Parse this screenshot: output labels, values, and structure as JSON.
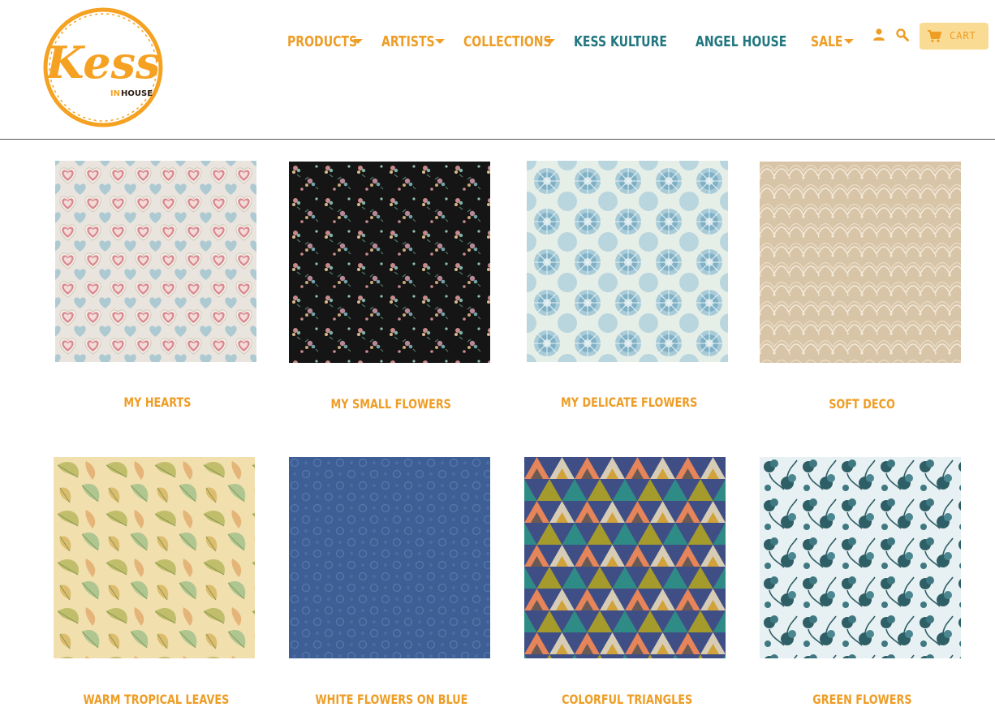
{
  "brand": {
    "logo_script": "Kess",
    "logo_in": "IN",
    "logo_house": "HOUSE"
  },
  "nav": {
    "items": [
      {
        "label": "Products",
        "has_dropdown": true
      },
      {
        "label": "Artists",
        "has_dropdown": true
      },
      {
        "label": "Collections",
        "has_dropdown": true
      },
      {
        "label": "Kess Kulture",
        "has_dropdown": false
      },
      {
        "label": "Angel House",
        "has_dropdown": false
      },
      {
        "label": "Sale",
        "has_dropdown": true
      }
    ],
    "account_icon": "user-icon",
    "search_icon": "search-icon",
    "cart_label": "CART",
    "cart_icon": "shopping-cart-icon"
  },
  "colors": {
    "accent": "#ee9d25",
    "teal": "#21767f",
    "cart_bg": "#fadb93"
  },
  "products": [
    {
      "title": "My Hearts"
    },
    {
      "title": "My Small Flowers"
    },
    {
      "title": "My Delicate Flowers"
    },
    {
      "title": "Soft Deco"
    },
    {
      "title": "Warm Tropical Leaves"
    },
    {
      "title": "White Flowers on Blue"
    },
    {
      "title": "Colorful Triangles"
    },
    {
      "title": "Green Flowers"
    }
  ]
}
